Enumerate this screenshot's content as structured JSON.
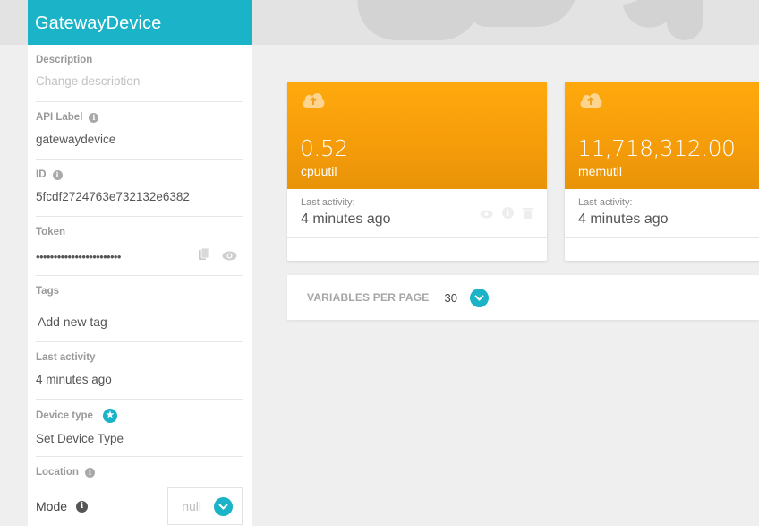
{
  "device": {
    "name": "GatewayDevice",
    "description": {
      "label": "Description",
      "placeholder": "Change description"
    },
    "api_label": {
      "label": "API Label",
      "value": "gatewaydevice"
    },
    "id": {
      "label": "ID",
      "value": "5fcdf2724763e732132e6382"
    },
    "token": {
      "label": "Token",
      "value": "••••••••••••••••••••••••"
    },
    "tags": {
      "label": "Tags",
      "placeholder": "Add new tag"
    },
    "last_activity": {
      "label": "Last activity",
      "value": "4 minutes ago"
    },
    "device_type": {
      "label": "Device type",
      "value": "Set Device Type"
    },
    "location": {
      "label": "Location"
    },
    "mode": {
      "label": "Mode",
      "value": "null"
    }
  },
  "variables": [
    {
      "value": "0.52",
      "name": "cpuutil",
      "activity_label": "Last activity:",
      "activity": "4 minutes ago",
      "icon": "cloud-upload-icon"
    },
    {
      "value": "11,718,312.00",
      "name": "memutil",
      "activity_label": "Last activity:",
      "activity": "4 minutes ago",
      "icon": "cloud-upload-icon"
    }
  ],
  "pagination": {
    "label": "VARIABLES PER PAGE",
    "value": "30"
  },
  "colors": {
    "accent": "#1ab3c7",
    "card": "#ffa90d",
    "background": "#efefef"
  }
}
